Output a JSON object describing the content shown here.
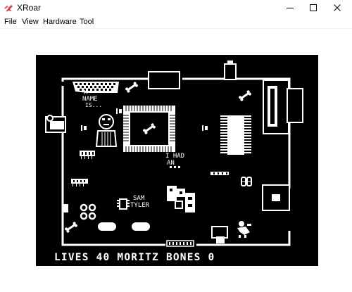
{
  "window": {
    "title": "XRoar",
    "icon": "xroar-bird-icon",
    "accent": "#d04040"
  },
  "menu": {
    "items": [
      "File",
      "View",
      "Hardware",
      "Tool"
    ]
  },
  "game": {
    "screen_bg": "#000000",
    "screen_fg": "#ffffff",
    "hud": {
      "lives_label": "LIVES",
      "lives_value": "40",
      "player_name": "MORITZ",
      "bones_label": "BONES",
      "bones_value": "0"
    },
    "labels": {
      "my_name_is_1": "M",
      "my_name_is_2": "NAME",
      "my_name_is_3": "IS...",
      "i_had_1": "I HAD",
      "i_had_2": "AN",
      "sam_1": "SAM",
      "sam_2": "TYLER"
    }
  }
}
